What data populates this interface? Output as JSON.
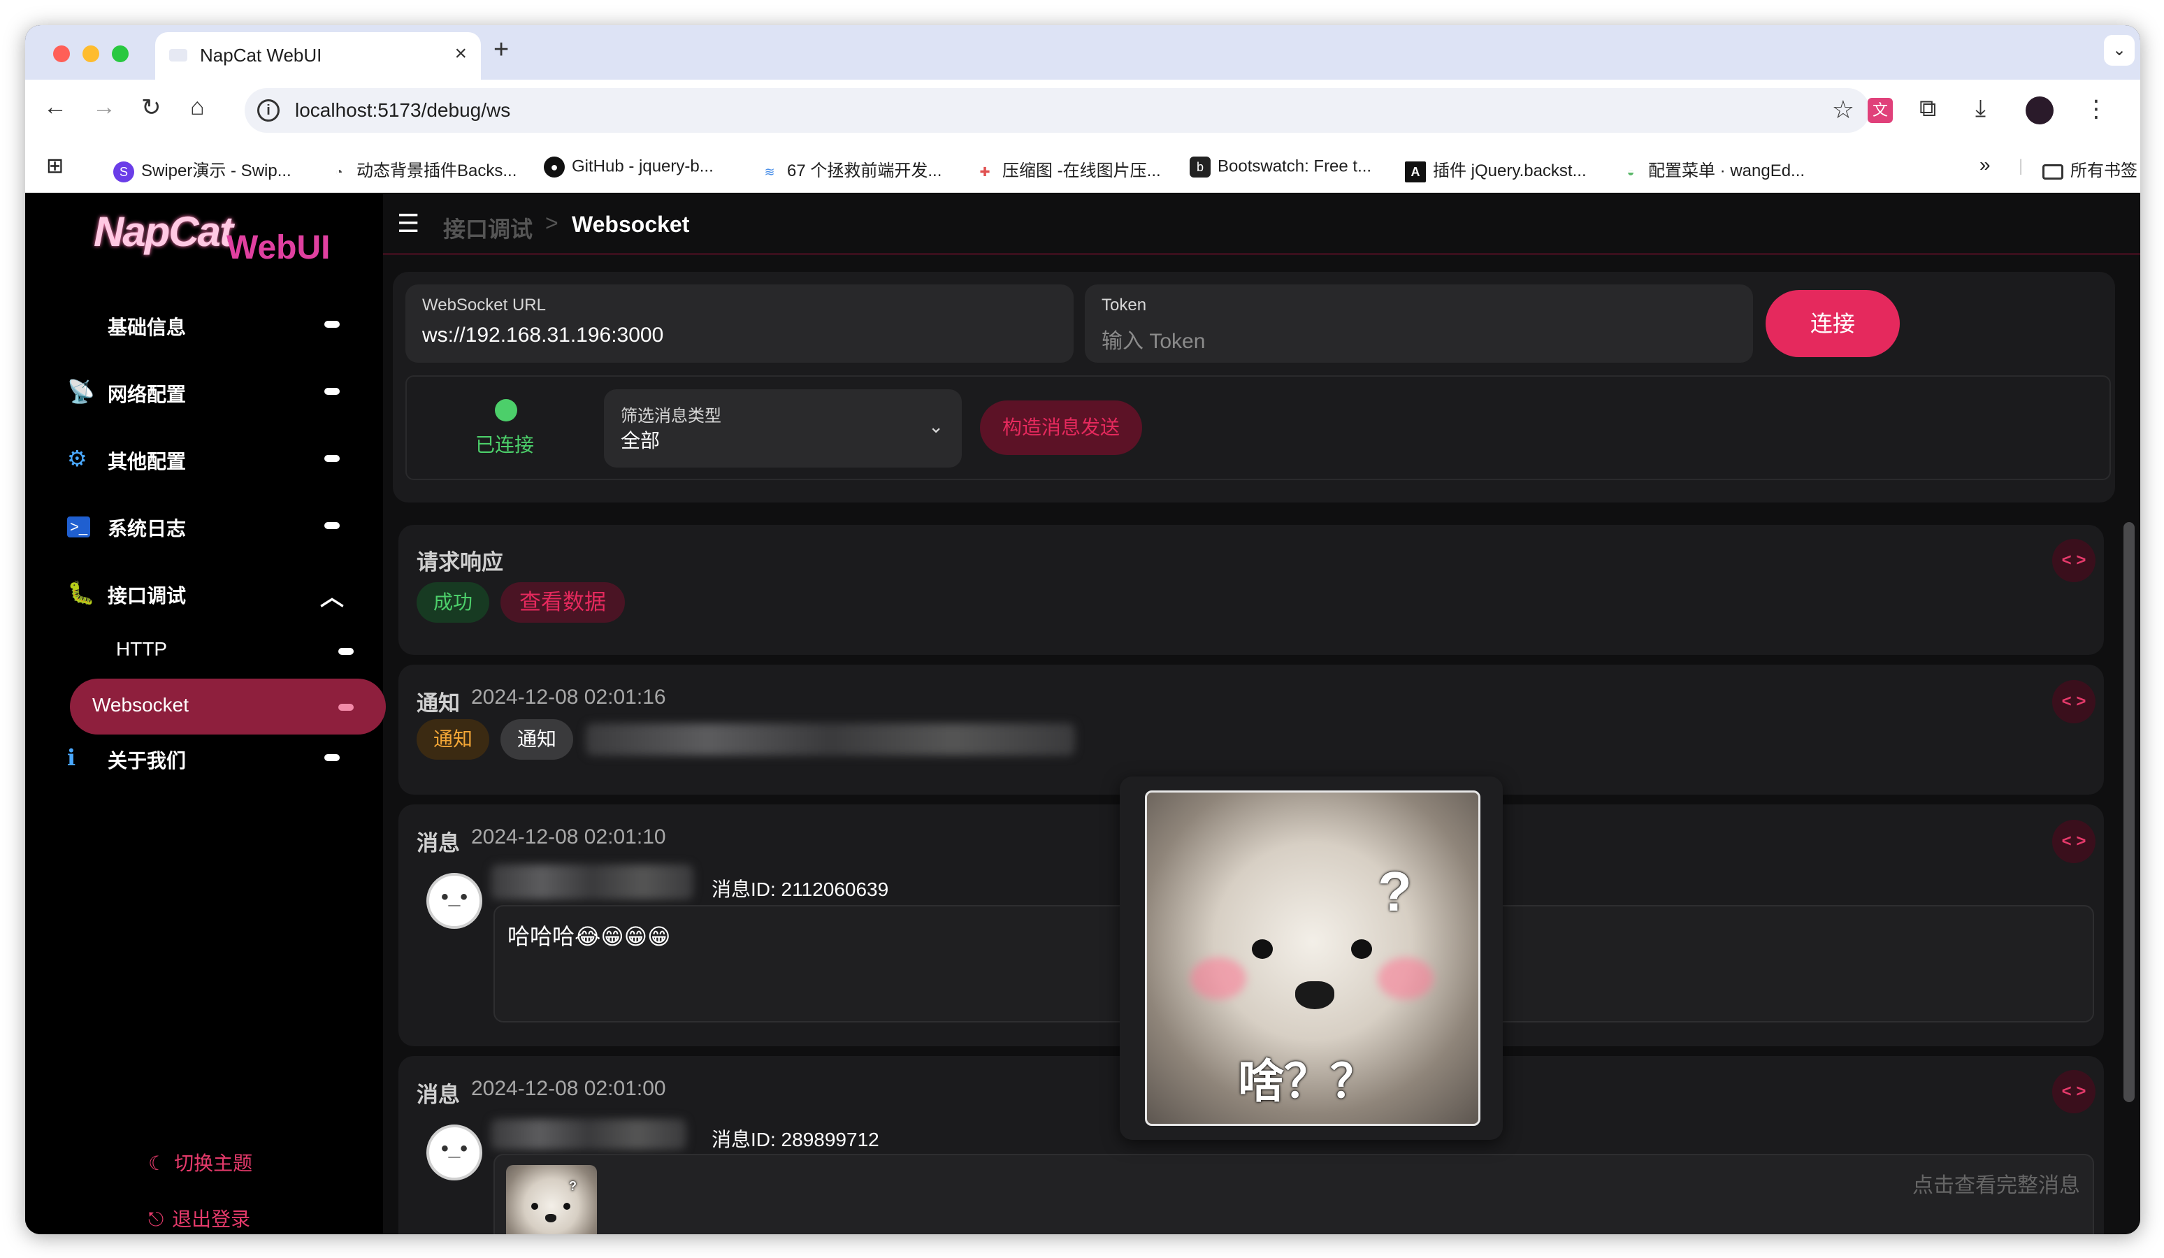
{
  "browser": {
    "tab_title": "NapCat WebUI",
    "tab_close": "×",
    "new_tab": "+",
    "tab_menu": "⌄",
    "url": "localhost:5173/debug/ws",
    "bookmarks": [
      {
        "label": "Swiper演示 - Swip...",
        "icon_text": "S",
        "color": "#6a3de8"
      },
      {
        "label": "动态背景插件Backs...",
        "icon_text": "◔",
        "color": "#444444"
      },
      {
        "label": "GitHub - jquery-b...",
        "icon_text": "●",
        "color": "#111111"
      },
      {
        "label": "67 个拯救前端开发...",
        "icon_text": "≋",
        "color": "#4a8fe8"
      },
      {
        "label": "压缩图 -在线图片压...",
        "icon_text": "✚",
        "color": "#e05050"
      },
      {
        "label": "Bootswatch: Free t...",
        "icon_text": "b",
        "color": "#222222"
      },
      {
        "label": "插件 jQuery.backst...",
        "icon_text": "A",
        "color": "#111111"
      },
      {
        "label": "配置菜单 · wangEd...",
        "icon_text": "◒",
        "color": "#5ab86a"
      }
    ],
    "bookmarks_more": "»",
    "all_bookmarks": "所有书签"
  },
  "sidebar": {
    "logo_text": "NapCat",
    "logo_suffix": "WebUI",
    "menu": [
      {
        "label": "基础信息",
        "icon": "🖥"
      },
      {
        "label": "网络配置",
        "icon": "📡"
      },
      {
        "label": "其他配置",
        "icon": "⚙"
      },
      {
        "label": "系统日志",
        "icon": ">_"
      },
      {
        "label": "接口调试",
        "icon": "🐛",
        "expanded": true
      }
    ],
    "submenu": [
      {
        "label": "HTTP",
        "active": false
      },
      {
        "label": "Websocket",
        "active": true
      }
    ],
    "about": {
      "label": "关于我们",
      "icon": "ℹ"
    },
    "toggle_theme": "切换主题",
    "logout": "退出登录"
  },
  "header": {
    "breadcrumb_parent": "接口调试",
    "breadcrumb_sep": ">",
    "breadcrumb_current": "Websocket"
  },
  "connect": {
    "url_label": "WebSocket URL",
    "url_value": "ws://192.168.31.196:3000",
    "token_label": "Token",
    "token_placeholder": "输入 Token",
    "connect_button": "连接",
    "status": "已连接",
    "status_color": "#4ccf6a",
    "filter_label": "筛选消息类型",
    "filter_value": "全部",
    "build_button": "构造消息发送"
  },
  "response": {
    "title": "请求响应",
    "success_chip": "成功",
    "view_data_chip": "查看数据"
  },
  "events": [
    {
      "type": "通知",
      "time": "2024-12-08 02:01:16",
      "chips": [
        "通知",
        "通知"
      ]
    },
    {
      "type": "消息",
      "time": "2024-12-08 02:01:10",
      "message_id": "消息ID: 2112060639",
      "text": "哈哈哈😂😁😁😁"
    },
    {
      "type": "消息",
      "time": "2024-12-08 02:01:00",
      "message_id": "消息ID: 289899712",
      "hint": "点击查看完整消息"
    }
  ],
  "popup_image": {
    "caption": "啥？？",
    "question": "?"
  },
  "code_icon": "< >",
  "colors": {
    "accent": "#e5295d",
    "sidebar_active": "#8e1f3d",
    "bg": "#0f0f10",
    "card": "#1b1b1d"
  }
}
